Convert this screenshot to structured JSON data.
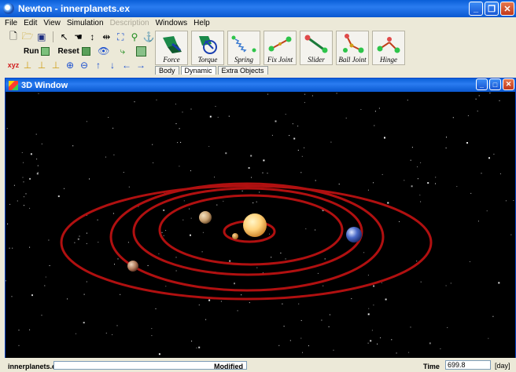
{
  "window": {
    "title": "Newton - innerplanets.ex"
  },
  "menu": {
    "items": [
      "File",
      "Edit",
      "View",
      "Simulation",
      "Description",
      "Windows",
      "Help"
    ],
    "disabled": [
      "Description"
    ]
  },
  "toolbar": {
    "run_label": "Run",
    "reset_label": "Reset",
    "icons_row1": [
      "new-file-icon",
      "open-folder-icon",
      "save-icon",
      "select-pointer-icon",
      "grab-hand-icon",
      "move-vertical-icon",
      "move-horizontal-icon",
      "fit-view-icon",
      "zoom-link-icon",
      "anchor-icon"
    ],
    "icons_row3": [
      "view-xyz-icon",
      "view-xy-icon",
      "view-xz-icon",
      "view-yz-icon",
      "zoom-in-icon",
      "zoom-out-icon",
      "arrow-up-icon",
      "arrow-down-icon",
      "arrow-left-icon",
      "arrow-right-icon"
    ]
  },
  "tools": [
    {
      "label": "Force"
    },
    {
      "label": "Torque"
    },
    {
      "label": "Spring"
    },
    {
      "label": "Fix Joint"
    },
    {
      "label": "Slider"
    },
    {
      "label": "Ball Joint"
    },
    {
      "label": "Hinge"
    }
  ],
  "tabs": [
    {
      "label": "Body",
      "active": false
    },
    {
      "label": "Dynamic",
      "active": true
    },
    {
      "label": "Extra Objects",
      "active": false
    }
  ],
  "window3d": {
    "title": "3D Window"
  },
  "colors": {
    "titlebar": "#0a5fd8",
    "orbit": "#b01010",
    "sun": "#ffd27a"
  },
  "statusbar": {
    "file": "innerplanets.ex",
    "state": "Modified",
    "time_label": "Time",
    "time_value": "699.8",
    "time_unit": "[day]"
  }
}
